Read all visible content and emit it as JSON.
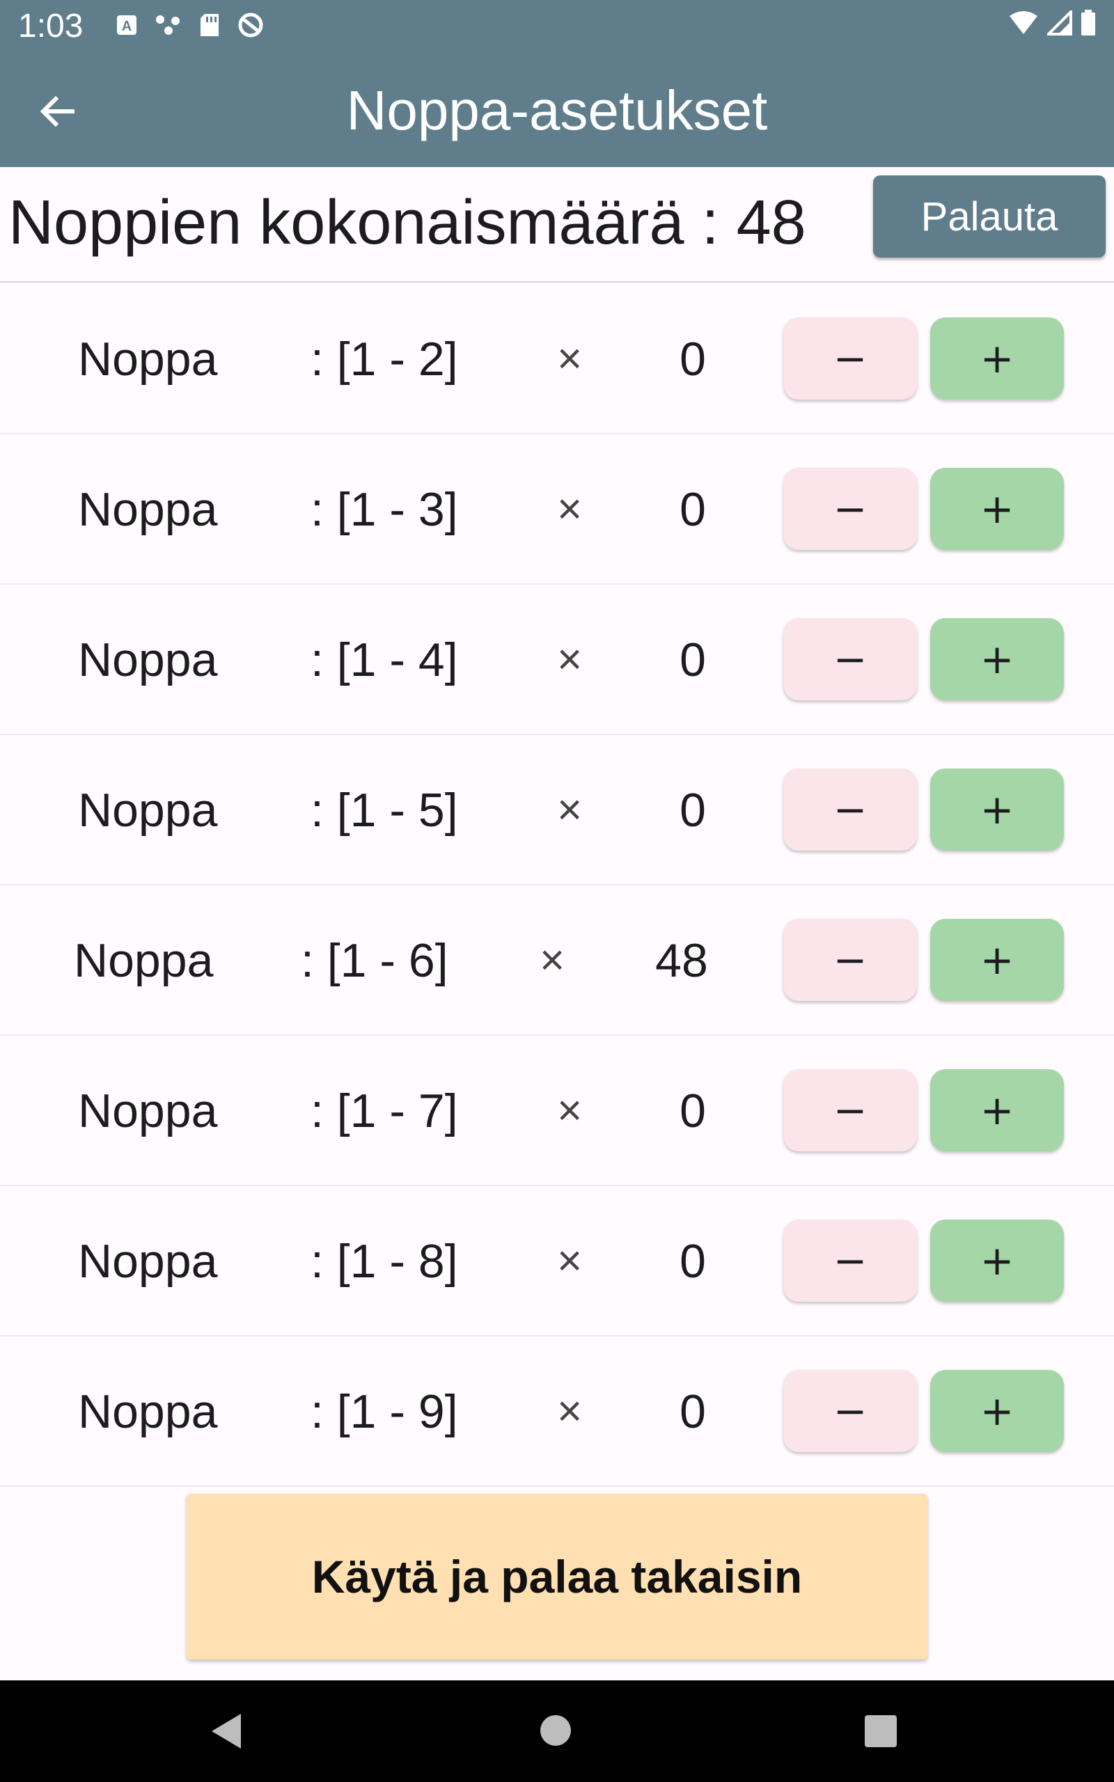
{
  "status_bar": {
    "time": "1:03",
    "left_icons": [
      "text-a-icon",
      "dots-icon",
      "sd-card-icon",
      "sync-icon"
    ],
    "right_icons": [
      "wifi-icon",
      "signal-icon",
      "battery-icon"
    ]
  },
  "app_bar": {
    "back_icon": "arrow-back-icon",
    "title": "Noppa-asetukset"
  },
  "summary": {
    "text": "Noppien kokonaismäärä : 48",
    "reset_label": "Palauta"
  },
  "dice": [
    {
      "name": "Noppa",
      "range": ": [1 - 2]",
      "times": "×",
      "count": "0",
      "minus": "−",
      "plus": "+"
    },
    {
      "name": "Noppa",
      "range": ": [1 - 3]",
      "times": "×",
      "count": "0",
      "minus": "−",
      "plus": "+"
    },
    {
      "name": "Noppa",
      "range": ": [1 - 4]",
      "times": "×",
      "count": "0",
      "minus": "−",
      "plus": "+"
    },
    {
      "name": "Noppa",
      "range": ": [1 - 5]",
      "times": "×",
      "count": "0",
      "minus": "−",
      "plus": "+"
    },
    {
      "name": "Noppa",
      "range": ": [1 - 6]",
      "times": "×",
      "count": "48",
      "minus": "−",
      "plus": "+"
    },
    {
      "name": "Noppa",
      "range": ": [1 - 7]",
      "times": "×",
      "count": "0",
      "minus": "−",
      "plus": "+"
    },
    {
      "name": "Noppa",
      "range": ": [1 - 8]",
      "times": "×",
      "count": "0",
      "minus": "−",
      "plus": "+"
    },
    {
      "name": "Noppa",
      "range": ": [1 - 9]",
      "times": "×",
      "count": "0",
      "minus": "−",
      "plus": "+"
    }
  ],
  "apply_label": "Käytä ja palaa takaisin",
  "nav_bar": {
    "icons": [
      "nav-back-icon",
      "nav-home-icon",
      "nav-recents-icon"
    ]
  },
  "colors": {
    "app_bar": "#607d8b",
    "minus_button": "#fbe4ea",
    "plus_button": "#a5d6a7",
    "apply_button": "#ffe0b2",
    "background": "#fffbfe"
  }
}
